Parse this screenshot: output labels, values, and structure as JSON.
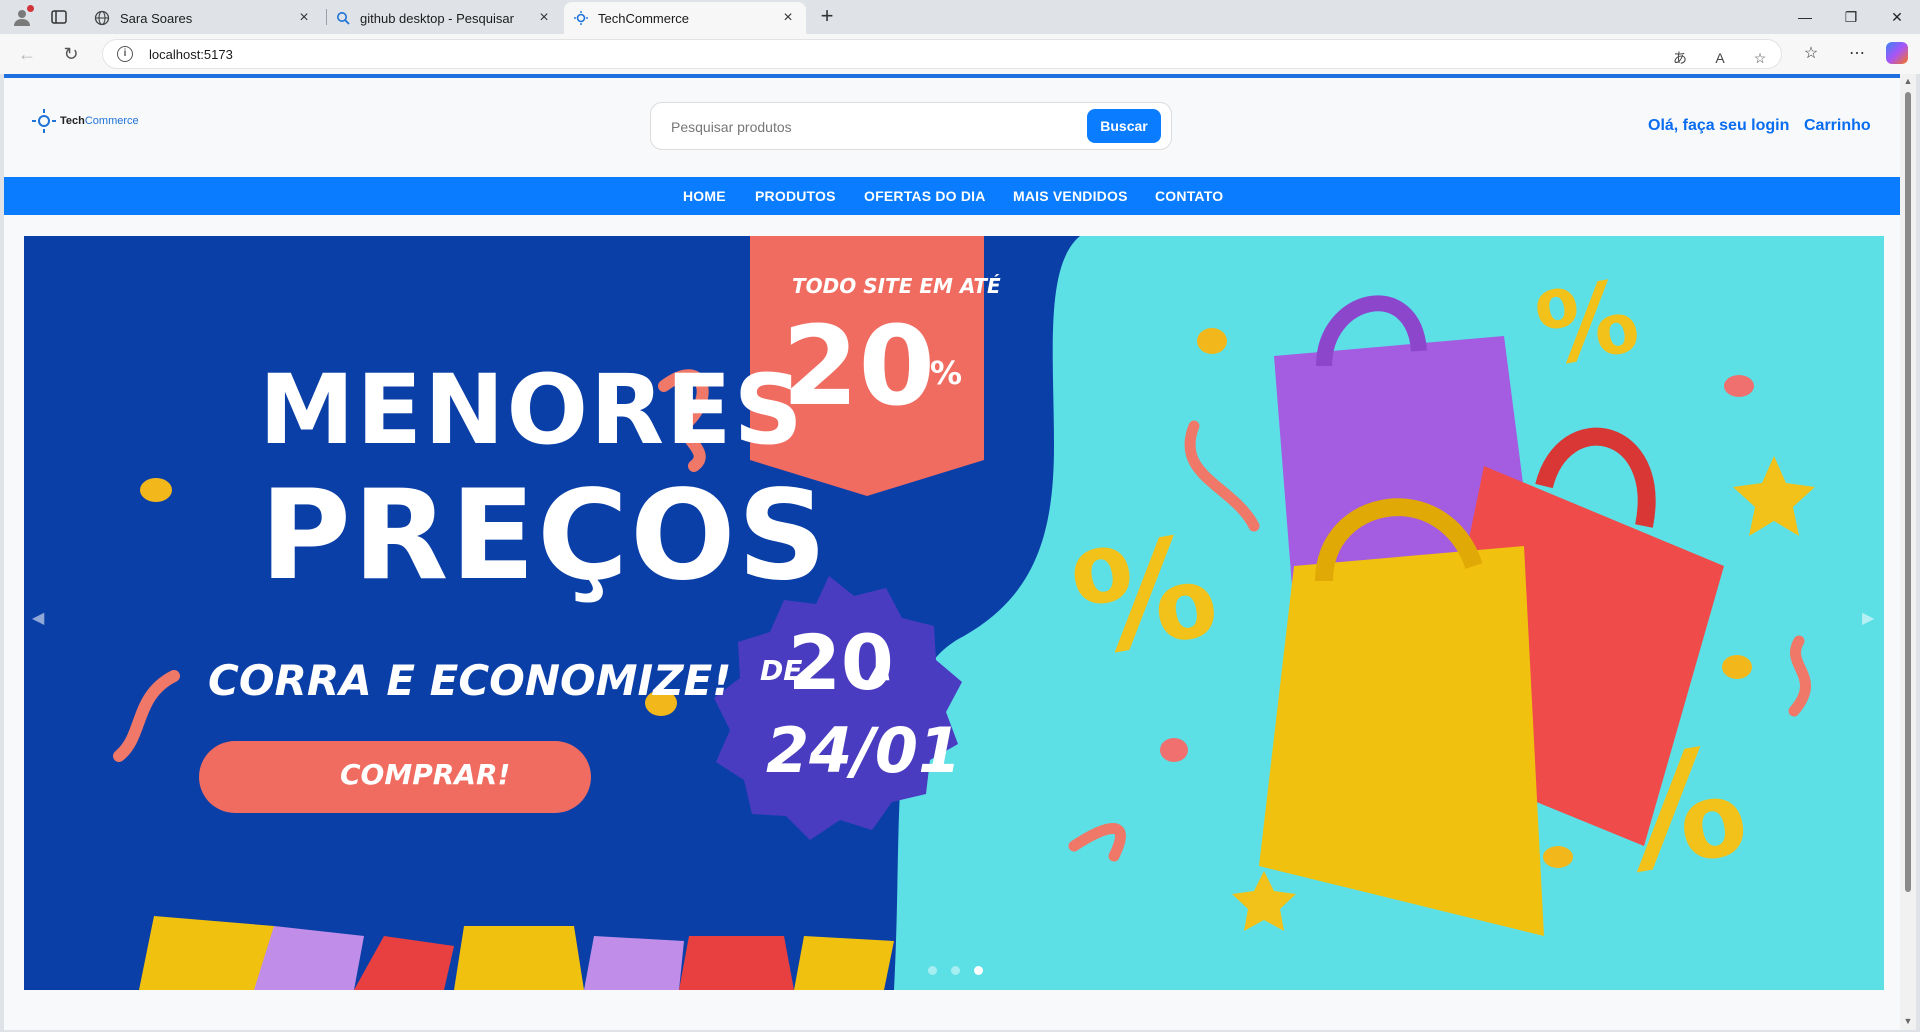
{
  "browser": {
    "tabs": [
      {
        "title": "Sara Soares",
        "icon": "globe-icon"
      },
      {
        "title": "github desktop - Pesquisar",
        "icon": "search-icon"
      },
      {
        "title": "TechCommerce",
        "icon": "techcommerce-favicon"
      }
    ],
    "url": "localhost:5173"
  },
  "header": {
    "logo_bold": "Tech",
    "logo_light": "Commerce",
    "search_placeholder": "Pesquisar produtos",
    "search_button": "Buscar",
    "login_link": "Olá, faça seu login",
    "cart_link": "Carrinho"
  },
  "nav": {
    "items": [
      "HOME",
      "PRODUTOS",
      "OFERTAS DO DIA",
      "MAIS VENDIDOS",
      "CONTATO"
    ]
  },
  "banner": {
    "line1": "MENORES",
    "line2": "PREÇOS",
    "line3": "CORRA E ECONOMIZE!",
    "button": "COMPRAR!",
    "ribbon_top": "TODO SITE EM ATÉ",
    "ribbon_value": "20",
    "ribbon_percent": "%",
    "badge_de": "DE",
    "badge_num": "20",
    "badge_a": "A",
    "badge_date": "24/01",
    "active_slide": 3,
    "slide_count": 3
  },
  "colors": {
    "accent": "#0a7cff",
    "banner_blue": "#0b3fa8",
    "banner_cyan": "#5ce0e6",
    "coral": "#f06b60",
    "badge_purple": "#4a3cc0"
  }
}
